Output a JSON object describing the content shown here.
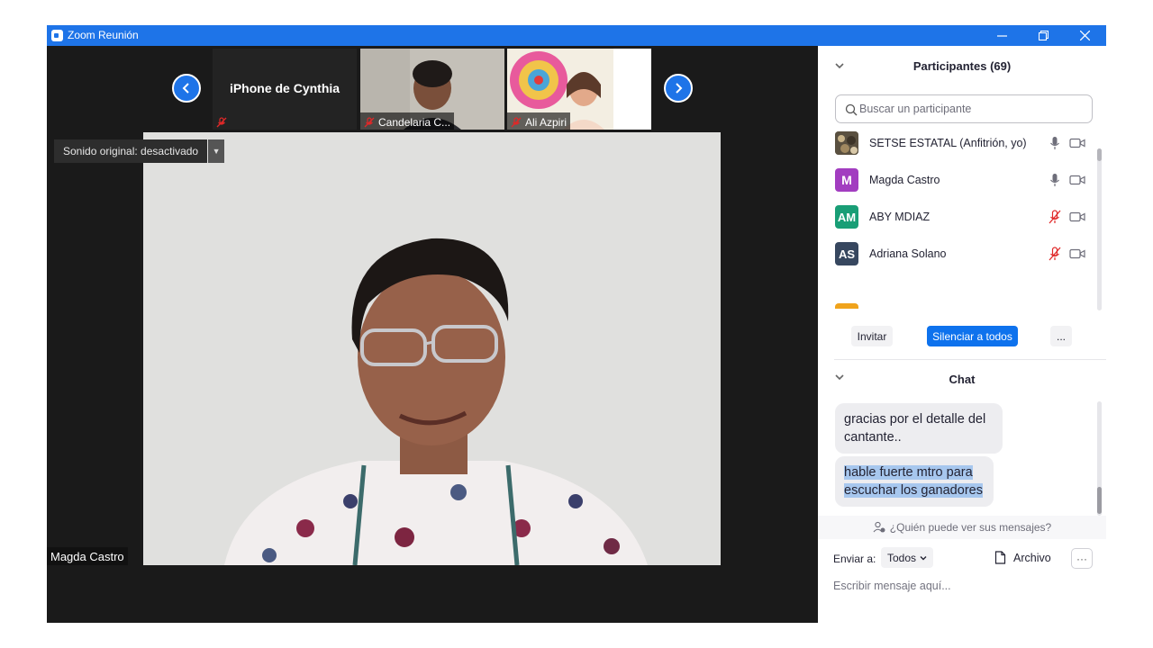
{
  "window": {
    "title": "Zoom Reunión",
    "minimize_label": "—",
    "maximize_label": "❐",
    "close_label": "✕"
  },
  "gallery": {
    "tiles": [
      {
        "name": "iPhone de Cynthia",
        "muted": true
      },
      {
        "name": "Candelaria C...",
        "muted": true
      },
      {
        "name": "Ali Azpiri",
        "muted": true
      }
    ]
  },
  "main_video": {
    "original_sound": "Sonido original: desactivado",
    "speaker_name": "Magda Castro"
  },
  "participants": {
    "header": "Participantes (69)",
    "search_placeholder": "Buscar un participante",
    "list": [
      {
        "name": "SETSE ESTATAL (Anfitrión, yo)",
        "initials": "",
        "color": "#6b5f4b",
        "mic": "on"
      },
      {
        "name": "Magda Castro",
        "initials": "M",
        "color": "#a23dc0",
        "mic": "on"
      },
      {
        "name": "ABY MDIAZ",
        "initials": "AM",
        "color": "#199e76",
        "mic": "muted"
      },
      {
        "name": "Adriana Solano",
        "initials": "AS",
        "color": "#37475f",
        "mic": "muted"
      }
    ],
    "next_avatar_color": "#f0a31c",
    "invite_label": "Invitar",
    "mute_all_label": "Silenciar a todos",
    "more_label": "..."
  },
  "chat": {
    "header": "Chat",
    "messages": [
      {
        "text": "gracias por el detalle del cantante..",
        "highlighted": false
      },
      {
        "text": "hable fuerte mtro para escuchar los ganadores",
        "highlighted": true
      }
    ],
    "who_sees": "¿Quién puede ver sus mensajes?",
    "send_to_label": "Enviar a:",
    "send_to_value": "Todos",
    "file_label": "Archivo",
    "more_label": "···",
    "input_placeholder": "Escribir mensaje aquí..."
  },
  "colors": {
    "accent": "#0e72ed",
    "titlebar": "#1e74e8",
    "muted_red": "#e02828"
  }
}
